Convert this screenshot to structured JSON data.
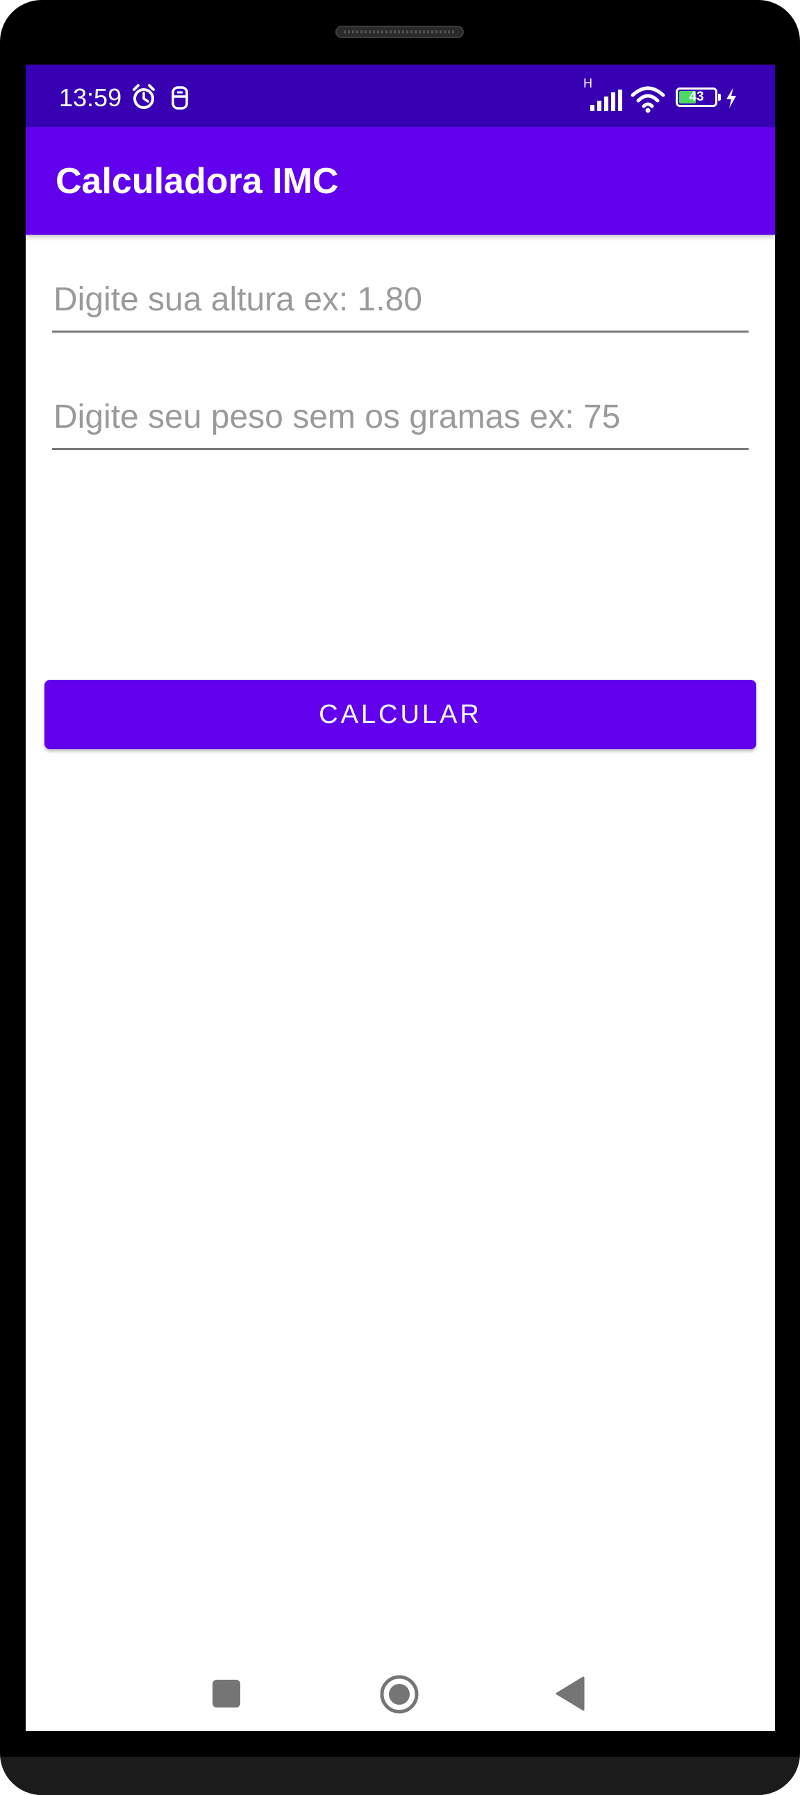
{
  "status_bar": {
    "time": "13:59",
    "battery_level": "43",
    "network_type": "H",
    "icons": [
      "alarm-icon",
      "notification-icon",
      "signal-icon",
      "wifi-icon",
      "battery-icon",
      "charging-icon"
    ],
    "background_color": "#3700b3"
  },
  "app_bar": {
    "title": "Calculadora IMC",
    "background_color": "#6200ee"
  },
  "form": {
    "height_placeholder": "Digite sua altura ex: 1.80",
    "height_value": "",
    "weight_placeholder": "Digite seu peso sem os gramas ex: 75",
    "weight_value": "",
    "calculate_label": "CALCULAR",
    "button_color": "#6200ee"
  },
  "nav_bar": {
    "items": [
      "recents-icon",
      "home-icon",
      "back-icon"
    ]
  }
}
